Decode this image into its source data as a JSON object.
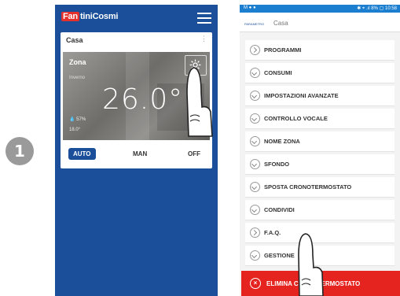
{
  "step": {
    "number": "1"
  },
  "left_phone": {
    "brand": {
      "mark": "Fan",
      "name": "tiniCosmi"
    },
    "card": {
      "title": "Casa",
      "more": "⋮",
      "zone": {
        "name": "Zona",
        "season": "Inverno",
        "temperature": "26.0°",
        "humidity": "57%",
        "setpoint": "18.0°"
      },
      "modes": {
        "auto": "AUTO",
        "man": "MAN",
        "off": "OFF"
      }
    }
  },
  "right_phone": {
    "status_bar": {
      "left": "M ● ●",
      "right": "✱ ⌖ .ıl 8% ▢ 10:58"
    },
    "header": {
      "tag": "PARAMETRO",
      "title": "Casa"
    },
    "menu": [
      {
        "label": "PROGRAMMI",
        "chevron": "right"
      },
      {
        "label": "CONSUMI",
        "chevron": "down"
      },
      {
        "label": "IMPOSTAZIONI AVANZATE",
        "chevron": "down"
      },
      {
        "label": "CONTROLLO VOCALE",
        "chevron": "down"
      },
      {
        "label": "NOME ZONA",
        "chevron": "down"
      },
      {
        "label": "SFONDO",
        "chevron": "down"
      },
      {
        "label": "SPOSTA CRONOTERMOSTATO",
        "chevron": "down"
      },
      {
        "label": "CONDIVIDI",
        "chevron": "down"
      },
      {
        "label": "F.A.Q.",
        "chevron": "right"
      },
      {
        "label": "GESTIONE",
        "chevron": "down"
      }
    ],
    "delete": {
      "label": "ELIMINA CRONOTERMOSTATO",
      "icon": "×"
    }
  }
}
